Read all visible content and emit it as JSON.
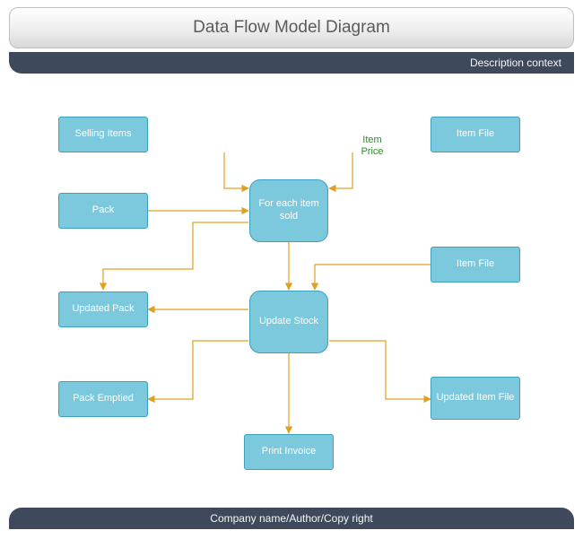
{
  "header": {
    "title": "Data Flow Model Diagram",
    "subtitle": "Description context"
  },
  "footer": {
    "text": "Company name/Author/Copy right"
  },
  "nodes": {
    "selling_items": "Selling Items",
    "item_file_top": "Item File",
    "pack": "Pack",
    "item_file_mid": "Item File",
    "updated_pack": "Updated Pack",
    "pack_emptied": "Pack Emptied",
    "updated_item_file": "Updated Item\nFile",
    "print_invoice": "Print Invoice",
    "for_each_item_sold": "For each item\nsold",
    "update_stock": "Update Stock"
  },
  "labels": {
    "item_price": "Item\nPrice"
  },
  "colors": {
    "node_fill": "#7cc8dd",
    "node_stroke": "#3da0bd",
    "bar": "#3e4a5b",
    "connector": "#e0a020",
    "label_green": "#2f8a2f"
  }
}
